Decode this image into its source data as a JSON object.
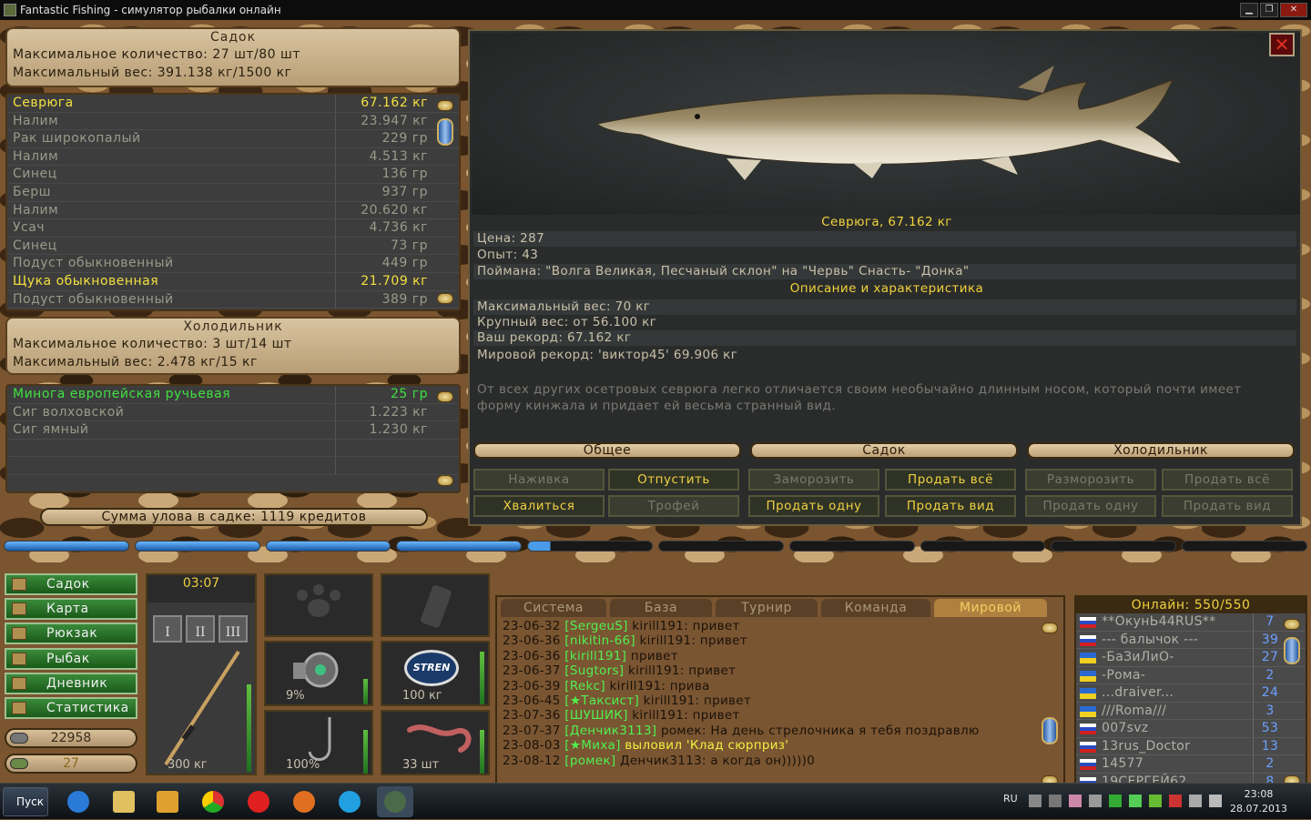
{
  "window": {
    "title": "Fantastic Fishing - симулятор рыбалки онлайн",
    "btn_min": "▁",
    "btn_max": "❐",
    "btn_close": "✕"
  },
  "sadok": {
    "title": "Садок",
    "max_count": "Максимальное количество: 27 шт/80 шт",
    "max_weight": "Максимальный вес: 391.138 кг/1500 кг",
    "items": [
      {
        "name": "Севрюга",
        "weight": "67.162 кг",
        "hl": "yellow"
      },
      {
        "name": "Налим",
        "weight": "23.947 кг"
      },
      {
        "name": "Рак широкопалый",
        "weight": "229 гр"
      },
      {
        "name": "Налим",
        "weight": "4.513 кг"
      },
      {
        "name": "Синец",
        "weight": "136 гр"
      },
      {
        "name": "Берш",
        "weight": "937 гр"
      },
      {
        "name": "Налим",
        "weight": "20.620 кг"
      },
      {
        "name": "Усач",
        "weight": "4.736 кг"
      },
      {
        "name": "Синец",
        "weight": "73 гр"
      },
      {
        "name": "Подуст обыкновенный",
        "weight": "449 гр"
      },
      {
        "name": "Щука обыкновенная",
        "weight": "21.709 кг",
        "hl": "yellow"
      },
      {
        "name": "Подуст обыкновенный",
        "weight": "389 гр"
      }
    ]
  },
  "fridge": {
    "title": "Холодильник",
    "max_count": "Максимальное количество: 3 шт/14 шт",
    "max_weight": "Максимальный вес: 2.478 кг/15 кг",
    "items": [
      {
        "name": "Минога европейская ручьевая",
        "weight": "25 гр",
        "hl": "green"
      },
      {
        "name": "Сиг волховской",
        "weight": "1.223 кг"
      },
      {
        "name": "Сиг ямный",
        "weight": "1.230 кг"
      },
      {
        "name": "",
        "weight": ""
      },
      {
        "name": "",
        "weight": ""
      }
    ]
  },
  "sum": "Сумма улова в садке: 1119 кредитов",
  "fish": {
    "caption": "Севрюга, 67.162 кг",
    "price": "Цена: 287",
    "exp": "Опыт: 43",
    "caught": "Поймана: \"Волга Великая, Песчаный склон\" на \"Червь\" Снасть- \"Донка\"",
    "desc_title": "Описание и характеристика",
    "max_w": "Максимальный вес: 70 кг",
    "big_w": "Крупный вес: от 56.100 кг",
    "your_rec": "Ваш рекорд: 67.162 кг",
    "world_rec": "Мировой рекорд: 'виктор45' 69.906 кг",
    "desc": "От всех других осетровых севрюга легко отличается своим необычайно длинным носом, который почти имеет форму кинжала и придает ей весьма странный вид.",
    "close": "✕"
  },
  "tabs": {
    "general": "Общее",
    "sadok": "Садок",
    "fridge": "Холодильник"
  },
  "buttons": {
    "bait": "Наживка",
    "release": "Отпустить",
    "brag": "Хвалиться",
    "trophy": "Трофей",
    "freeze": "Заморозить",
    "sell_all": "Продать всё",
    "sell_one": "Продать одну",
    "sell_kind": "Продать вид",
    "unfreeze": "Разморозить",
    "sell_all2": "Продать всё",
    "sell_one2": "Продать одну",
    "sell_kind2": "Продать вид"
  },
  "nav": [
    "Садок",
    "Карта",
    "Рюкзак",
    "Рыбак",
    "Дневник",
    "Статистика"
  ],
  "stats": {
    "money": "22958",
    "gold": "27"
  },
  "gear": {
    "time": "03:07",
    "rod_cap": "300 кг",
    "reel": "9%",
    "line": "100 кг",
    "hook": "100%",
    "bait": "33 шт",
    "rod_btns": [
      "I",
      "II",
      "III"
    ],
    "line_brand": "STREN"
  },
  "chat": {
    "tabs": [
      "Система",
      "База",
      "Турнир",
      "Команда",
      "Мировой"
    ],
    "lines": [
      {
        "t": "23-06-32",
        "u": "[SergeuS]",
        "m": " kirill191: привет"
      },
      {
        "t": "23-06-36",
        "u": "[nikitin-66]",
        "m": " kirill191: привет"
      },
      {
        "t": "23-06-36",
        "u": "[kirill191]",
        "m": " привет"
      },
      {
        "t": "23-06-37",
        "u": "[Sugtors]",
        "m": " kirill191: привет"
      },
      {
        "t": "23-06-39",
        "u": "[Rekc]",
        "m": " kirill191: прива"
      },
      {
        "t": "23-06-45",
        "u": "[★Таксист]",
        "m": " kirill191: привет"
      },
      {
        "t": "23-07-36",
        "u": "[ШУШИК]",
        "m": " kirill191: привет"
      },
      {
        "t": "23-07-37",
        "u": "[Денчик3113]",
        "m": " ромек: На день стрелочника я тебя поздравлю"
      },
      {
        "t": "23-08-03",
        "u": "[★Миха]",
        "m": " выловил 'Клад сюрприз'",
        "y": true
      },
      {
        "t": "23-08-12",
        "u": "[ромек]",
        "m": " Денчик3113: а когда он)))))0"
      }
    ]
  },
  "online": {
    "title": "Онлайн: 550/550",
    "users": [
      {
        "f": "ru",
        "n": "**ОкунЬ44RUS**",
        "l": "7"
      },
      {
        "f": "ru",
        "n": "--- балычок ---",
        "l": "39"
      },
      {
        "f": "ua",
        "n": "-БаЗиЛиО-",
        "l": "27"
      },
      {
        "f": "ua",
        "n": "-Рома-",
        "l": "2"
      },
      {
        "f": "ua",
        "n": "...draiver...",
        "l": "24"
      },
      {
        "f": "ua",
        "n": "///Roma///",
        "l": "3"
      },
      {
        "f": "ru",
        "n": "007svz",
        "l": "53"
      },
      {
        "f": "ru",
        "n": "13rus_Doctor",
        "l": "13"
      },
      {
        "f": "ru",
        "n": "14577",
        "l": "2"
      },
      {
        "f": "ru",
        "n": "19СЕРГЕЙ62",
        "l": "8"
      }
    ]
  },
  "taskbar": {
    "start": "Пуск",
    "lang": "RU",
    "time": "23:08",
    "date": "28.07.2013"
  }
}
